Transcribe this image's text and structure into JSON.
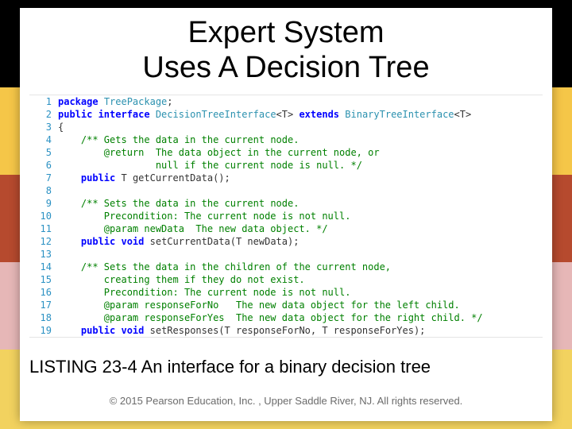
{
  "title_line1": "Expert System",
  "title_line2": "Uses A Decision Tree",
  "caption": "LISTING 23-4 An interface for a binary decision tree",
  "copyright": "© 2015 Pearson Education, Inc. , Upper Saddle River, NJ.  All rights reserved.",
  "code": {
    "lines": [
      {
        "n": "1",
        "seg": [
          {
            "c": "kw",
            "t": "package"
          },
          {
            "c": "",
            "t": " "
          },
          {
            "c": "ty",
            "t": "TreePackage"
          },
          {
            "c": "",
            "t": ";"
          }
        ]
      },
      {
        "n": "2",
        "seg": [
          {
            "c": "kw",
            "t": "public interface"
          },
          {
            "c": "",
            "t": " "
          },
          {
            "c": "ty",
            "t": "DecisionTreeInterface"
          },
          {
            "c": "",
            "t": "<T> "
          },
          {
            "c": "kw",
            "t": "extends"
          },
          {
            "c": "",
            "t": " "
          },
          {
            "c": "ty",
            "t": "BinaryTreeInterface"
          },
          {
            "c": "",
            "t": "<T>"
          }
        ]
      },
      {
        "n": "3",
        "seg": [
          {
            "c": "",
            "t": "{"
          }
        ]
      },
      {
        "n": "4",
        "seg": [
          {
            "c": "",
            "t": "    "
          },
          {
            "c": "cm",
            "t": "/** Gets the data in the current node."
          }
        ]
      },
      {
        "n": "5",
        "seg": [
          {
            "c": "",
            "t": "        "
          },
          {
            "c": "cm",
            "t": "@return  The data object in the current node, or"
          }
        ]
      },
      {
        "n": "6",
        "seg": [
          {
            "c": "",
            "t": "                 "
          },
          {
            "c": "cm",
            "t": "null if the current node is null. */"
          }
        ]
      },
      {
        "n": "7",
        "seg": [
          {
            "c": "",
            "t": "    "
          },
          {
            "c": "kw",
            "t": "public"
          },
          {
            "c": "",
            "t": " T getCurrentData();"
          }
        ]
      },
      {
        "n": "8",
        "seg": []
      },
      {
        "n": "9",
        "seg": [
          {
            "c": "",
            "t": "    "
          },
          {
            "c": "cm",
            "t": "/** Sets the data in the current node."
          }
        ]
      },
      {
        "n": "10",
        "seg": [
          {
            "c": "",
            "t": "        "
          },
          {
            "c": "cm",
            "t": "Precondition: The current node is not null."
          }
        ]
      },
      {
        "n": "11",
        "seg": [
          {
            "c": "",
            "t": "        "
          },
          {
            "c": "cm",
            "t": "@param newData  The new data object. */"
          }
        ]
      },
      {
        "n": "12",
        "seg": [
          {
            "c": "",
            "t": "    "
          },
          {
            "c": "kw",
            "t": "public void"
          },
          {
            "c": "",
            "t": " setCurrentData(T newData);"
          }
        ]
      },
      {
        "n": "13",
        "seg": []
      },
      {
        "n": "14",
        "seg": [
          {
            "c": "",
            "t": "    "
          },
          {
            "c": "cm",
            "t": "/** Sets the data in the children of the current node,"
          }
        ]
      },
      {
        "n": "15",
        "seg": [
          {
            "c": "",
            "t": "        "
          },
          {
            "c": "cm",
            "t": "creating them if they do not exist."
          }
        ]
      },
      {
        "n": "16",
        "seg": [
          {
            "c": "",
            "t": "        "
          },
          {
            "c": "cm",
            "t": "Precondition: The current node is not null."
          }
        ]
      },
      {
        "n": "17",
        "seg": [
          {
            "c": "",
            "t": "        "
          },
          {
            "c": "cm",
            "t": "@param responseForNo   The new data object for the left child."
          }
        ]
      },
      {
        "n": "18",
        "seg": [
          {
            "c": "",
            "t": "        "
          },
          {
            "c": "cm",
            "t": "@param responseForYes  The new data object for the right child. */"
          }
        ]
      },
      {
        "n": "19",
        "seg": [
          {
            "c": "",
            "t": "    "
          },
          {
            "c": "kw",
            "t": "public void"
          },
          {
            "c": "",
            "t": " setResponses(T responseForNo, T responseForYes);"
          }
        ]
      }
    ]
  }
}
